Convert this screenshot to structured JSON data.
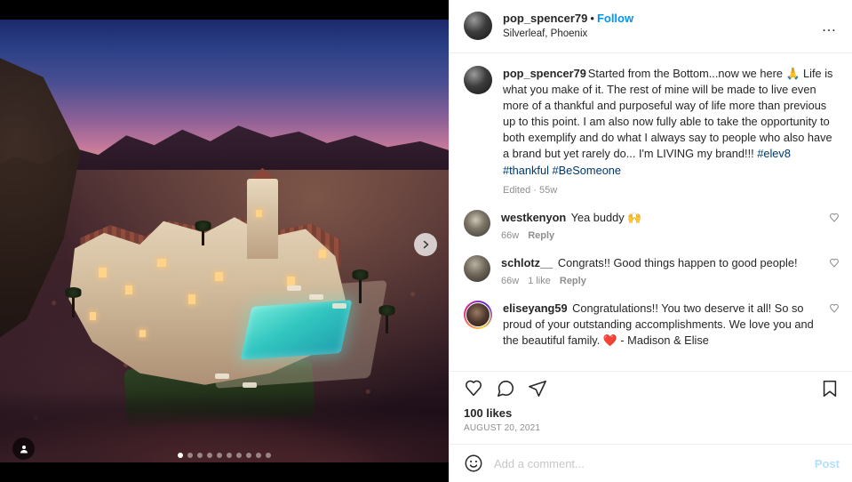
{
  "post": {
    "header": {
      "username": "pop_spencer79",
      "separator": "•",
      "follow_label": "Follow",
      "location": "Silverleaf, Phoenix",
      "more_icon": "…",
      "more_name": "more-options-icon"
    },
    "caption": {
      "username": "pop_spencer79",
      "text": "Started from the Bottom...now we here 🙏 Life is what you make of it. The rest of mine will be made to live even more of a thankful and purposeful way of life more than previous up to this point. I am also now fully able to take the opportunity to both exemplify and do what I always say to people who also have a brand but yet rarely do... I'm LIVING my brand!!! ",
      "hashtags": "#elev8 #thankful #BeSomeone",
      "meta": "Edited · 55w"
    },
    "comments": [
      {
        "username": "westkenyon",
        "text": "Yea buddy 🙌",
        "time": "66w",
        "likes": "",
        "reply_label": "Reply",
        "has_story_ring": false
      },
      {
        "username": "schlotz__",
        "text": "Congrats!! Good things happen to good people!",
        "time": "66w",
        "likes": "1 like",
        "reply_label": "Reply",
        "has_story_ring": false
      },
      {
        "username": "eliseyang59",
        "text": "Congratulations!! You two deserve it all! So so proud of your outstanding accomplishments. We love you and the beautiful family. ❤️ - Madison & Elise",
        "time": "",
        "likes": "",
        "reply_label": "",
        "has_story_ring": true
      }
    ],
    "actions": {
      "like_name": "like-icon",
      "comment_name": "comment-icon",
      "share_name": "share-icon",
      "save_name": "save-icon"
    },
    "likes_count": "100 likes",
    "date": "AUGUST 20, 2021",
    "add_comment": {
      "placeholder": "Add a comment...",
      "value": "",
      "post_label": "Post",
      "emoji_icon": "emoji-icon"
    },
    "media": {
      "next_label": "›",
      "dot_count": 10,
      "active_dot": 0,
      "tag_icon": "tagged-people-icon"
    },
    "colors": {
      "accent_blue": "#0095f6",
      "link_blue": "#00376b",
      "post_disabled": "#b2dffc",
      "text": "#262626",
      "muted": "#8e8e8e",
      "border": "#efefef"
    }
  }
}
